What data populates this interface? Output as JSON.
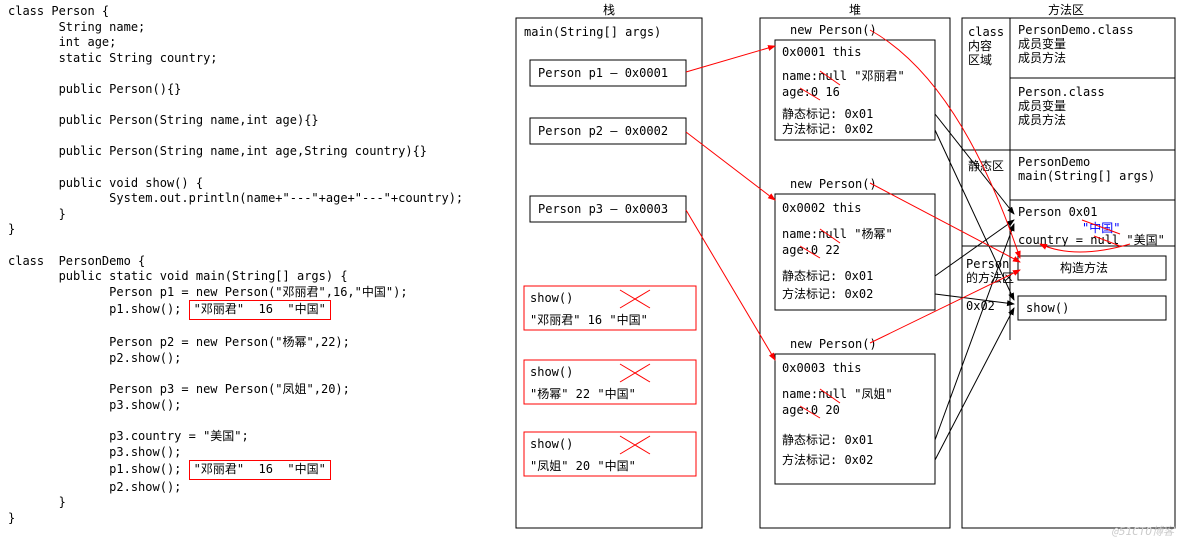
{
  "code": {
    "lines": [
      "class Person {",
      "       String name;",
      "       int age;",
      "       static String country;",
      "",
      "       public Person(){}",
      "",
      "       public Person(String name,int age){}",
      "",
      "       public Person(String name,int age,String country){}",
      "",
      "       public void show() {",
      "              System.out.println(name+\"---\"+age+\"---\"+country);",
      "       }",
      "}",
      "",
      "class  PersonDemo {",
      "       public static void main(String[] args) {",
      "              Person p1 = new Person(\"邓丽君\",16,\"中国\");",
      "              p1.show();",
      "",
      "              Person p2 = new Person(\"杨幂\",22);",
      "              p2.show();",
      "",
      "              Person p3 = new Person(\"凤姐\",20);",
      "              p3.show();",
      "",
      "              p3.country = \"美国\";",
      "              p3.show();",
      "              p1.show();",
      "              p2.show();",
      "       }",
      "}"
    ],
    "inlineOutput": "\"邓丽君\"  16  \"中国\""
  },
  "columns": {
    "stack": "栈",
    "heap": "堆",
    "method": "方法区"
  },
  "stack": {
    "main": "main(String[] args)",
    "p1": "Person p1 — 0x0001",
    "p2": "Person p2 — 0x0002",
    "p3": "Person p3 — 0x0003",
    "show1": {
      "call": "show()",
      "out": "\"邓丽君\"  16  \"中国\""
    },
    "show2": {
      "call": "show()",
      "out": "\"杨幂\"   22  \"中国\""
    },
    "show3": {
      "call": "show()",
      "out": "\"凤姐\"   20  \"中国\""
    }
  },
  "heap": {
    "obj1": {
      "title": "new Person()",
      "this": "0x0001   this",
      "name": "name:null  \"邓丽君\"",
      "age": "age:0   16",
      "staticMark": "静态标记:   0x01",
      "methodMark": "方法标记:   0x02"
    },
    "obj2": {
      "title": "new Person()",
      "this": "0x0002 this",
      "name": "name:null  \"杨幂\"",
      "age": "age:0   22",
      "staticMark": "静态标记:  0x01",
      "methodMark": "方法标记:  0x02"
    },
    "obj3": {
      "title": "new Person()",
      "this": "0x0003 this",
      "name": "name:null \"凤姐\"",
      "age": "age:0   20",
      "staticMark": "静态标记:  0x01",
      "methodMark": "方法标记:  0x02"
    }
  },
  "method": {
    "classArea": "class\n内容\n区域",
    "demoClass": "PersonDemo.class\n成员变量\n成员方法",
    "personClass": "Person.class\n成员变量\n成员方法",
    "staticArea": "静态区",
    "demoMain": "PersonDemo\nmain(String[] args)",
    "personStatic1": "Person    0x01",
    "personStatic2": "country = null \"美国\"",
    "countryOld": "\"中国\"",
    "personMethodArea": "Person\n的方法区",
    "ctor": "构造方法",
    "addr02": "0x02",
    "show": "show()"
  },
  "watermark": "@51CTO博客"
}
